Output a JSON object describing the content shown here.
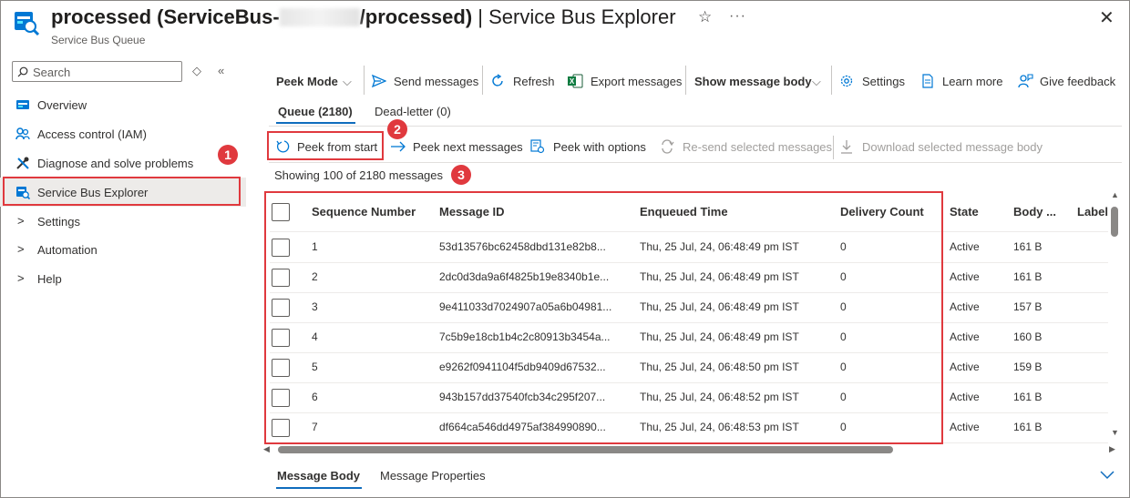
{
  "header": {
    "title_prefix": "processed (ServiceBus-",
    "title_suffix": "/processed)",
    "title_separator": " | ",
    "title_app": "Service Bus Explorer",
    "subtitle": "Service Bus Queue",
    "star_icon": "☆",
    "more_icon": "···",
    "close_icon": "✕"
  },
  "sidebar": {
    "search_placeholder": "Search",
    "items": [
      {
        "label": "Overview",
        "icon": "overview-icon"
      },
      {
        "label": "Access control (IAM)",
        "icon": "iam-icon"
      },
      {
        "label": "Diagnose and solve problems",
        "icon": "wrench-icon"
      },
      {
        "label": "Service Bus Explorer",
        "icon": "service-bus-explorer-icon",
        "active": true
      },
      {
        "label": "Settings",
        "icon": "chevron-right-icon"
      },
      {
        "label": "Automation",
        "icon": "chevron-right-icon"
      },
      {
        "label": "Help",
        "icon": "chevron-right-icon"
      }
    ]
  },
  "toolbar": {
    "peek_mode": "Peek Mode",
    "send_messages": "Send messages",
    "refresh": "Refresh",
    "export_messages": "Export messages",
    "show_message_body": "Show message body",
    "settings": "Settings",
    "learn_more": "Learn more",
    "give_feedback": "Give feedback"
  },
  "tabs": {
    "queue": "Queue (2180)",
    "dead_letter": "Dead-letter (0)"
  },
  "actions": {
    "peek_from_start": "Peek from start",
    "peek_next": "Peek next messages",
    "peek_with_options": "Peek with options",
    "resend": "Re-send selected messages",
    "download": "Download selected message body"
  },
  "status": {
    "showing": "Showing 100 of 2180 messages"
  },
  "badges": [
    "1",
    "2",
    "3"
  ],
  "table": {
    "columns": [
      "Sequence Number",
      "Message ID",
      "Enqueued Time",
      "Delivery Count",
      "State",
      "Body ...",
      "Label/"
    ],
    "rows": [
      {
        "seq": "1",
        "id": "53d13576bc62458dbd131e82b8...",
        "time": "Thu, 25 Jul, 24, 06:48:49 pm IST",
        "count": "0",
        "state": "Active",
        "body": "161 B"
      },
      {
        "seq": "2",
        "id": "2dc0d3da9a6f4825b19e8340b1e...",
        "time": "Thu, 25 Jul, 24, 06:48:49 pm IST",
        "count": "0",
        "state": "Active",
        "body": "161 B"
      },
      {
        "seq": "3",
        "id": "9e411033d7024907a05a6b04981...",
        "time": "Thu, 25 Jul, 24, 06:48:49 pm IST",
        "count": "0",
        "state": "Active",
        "body": "157 B"
      },
      {
        "seq": "4",
        "id": "7c5b9e18cb1b4c2c80913b3454a...",
        "time": "Thu, 25 Jul, 24, 06:48:49 pm IST",
        "count": "0",
        "state": "Active",
        "body": "160 B"
      },
      {
        "seq": "5",
        "id": "e9262f0941104f5db9409d67532...",
        "time": "Thu, 25 Jul, 24, 06:48:50 pm IST",
        "count": "0",
        "state": "Active",
        "body": "159 B"
      },
      {
        "seq": "6",
        "id": "943b157dd37540fcb34c295f207...",
        "time": "Thu, 25 Jul, 24, 06:48:52 pm IST",
        "count": "0",
        "state": "Active",
        "body": "161 B"
      },
      {
        "seq": "7",
        "id": "df664ca546dd4975af384990890...",
        "time": "Thu, 25 Jul, 24, 06:48:53 pm IST",
        "count": "0",
        "state": "Active",
        "body": "161 B"
      }
    ]
  },
  "bottom_tabs": {
    "message_body": "Message Body",
    "message_properties": "Message Properties"
  },
  "colors": {
    "accent": "#0f6cbd",
    "highlight": "#e0393e"
  }
}
